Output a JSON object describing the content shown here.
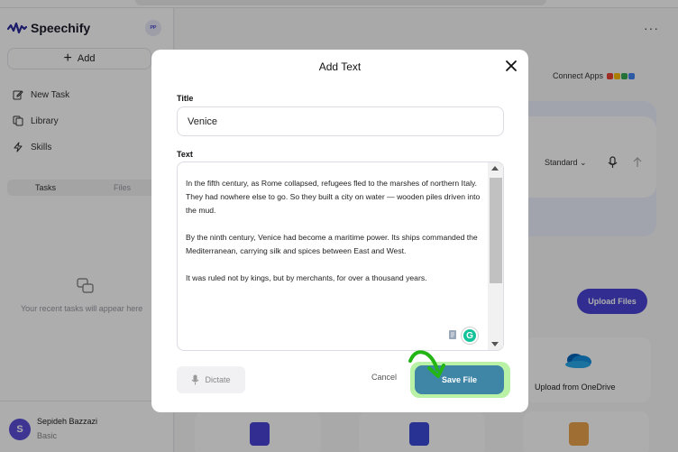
{
  "app": {
    "name": "Speechify",
    "collapse_label": "ᴾᴾ"
  },
  "sidebar": {
    "add_label": "Add",
    "items": [
      {
        "label": "New Task",
        "icon": "edit-icon"
      },
      {
        "label": "Library",
        "icon": "library-icon"
      },
      {
        "label": "Skills",
        "icon": "bolt-icon"
      }
    ],
    "tabs": [
      {
        "label": "Tasks",
        "active": true
      },
      {
        "label": "Files",
        "active": false
      }
    ],
    "empty_text": "Your recent tasks will appear here",
    "user": {
      "initial": "S",
      "name": "Sepideh Bazzazi",
      "plan": "Basic"
    }
  },
  "main": {
    "menu_label": "···",
    "connect_label": "Connect Apps",
    "voice_mode": "Standard",
    "upload_files_label": "Upload Files",
    "onedrive_label": "Upload from OneDrive"
  },
  "modal": {
    "title": "Add Text",
    "title_label": "Title",
    "title_value": "Venice",
    "text_label": "Text",
    "paragraphs": [
      "In the fifth century, as Rome collapsed, refugees fled to the marshes of northern Italy. They had nowhere else to go. So they built a city on water — wooden piles driven into the mud.",
      "By the ninth century, Venice had become a maritime power. Its ships commanded the Mediterranean, carrying silk and spices between East and West.",
      "It was ruled not by kings, but by merchants, for over a thousand years."
    ],
    "grammarly_glyph": "G",
    "dictate_label": "Dictate",
    "cancel_label": "Cancel",
    "save_label": "Save File"
  },
  "colors": {
    "accent": "#4b45d6",
    "save_button": "#3f86a6",
    "save_highlight": "#b9f2a6",
    "annotation_arrow": "#22b514",
    "grammarly": "#15c39a"
  }
}
